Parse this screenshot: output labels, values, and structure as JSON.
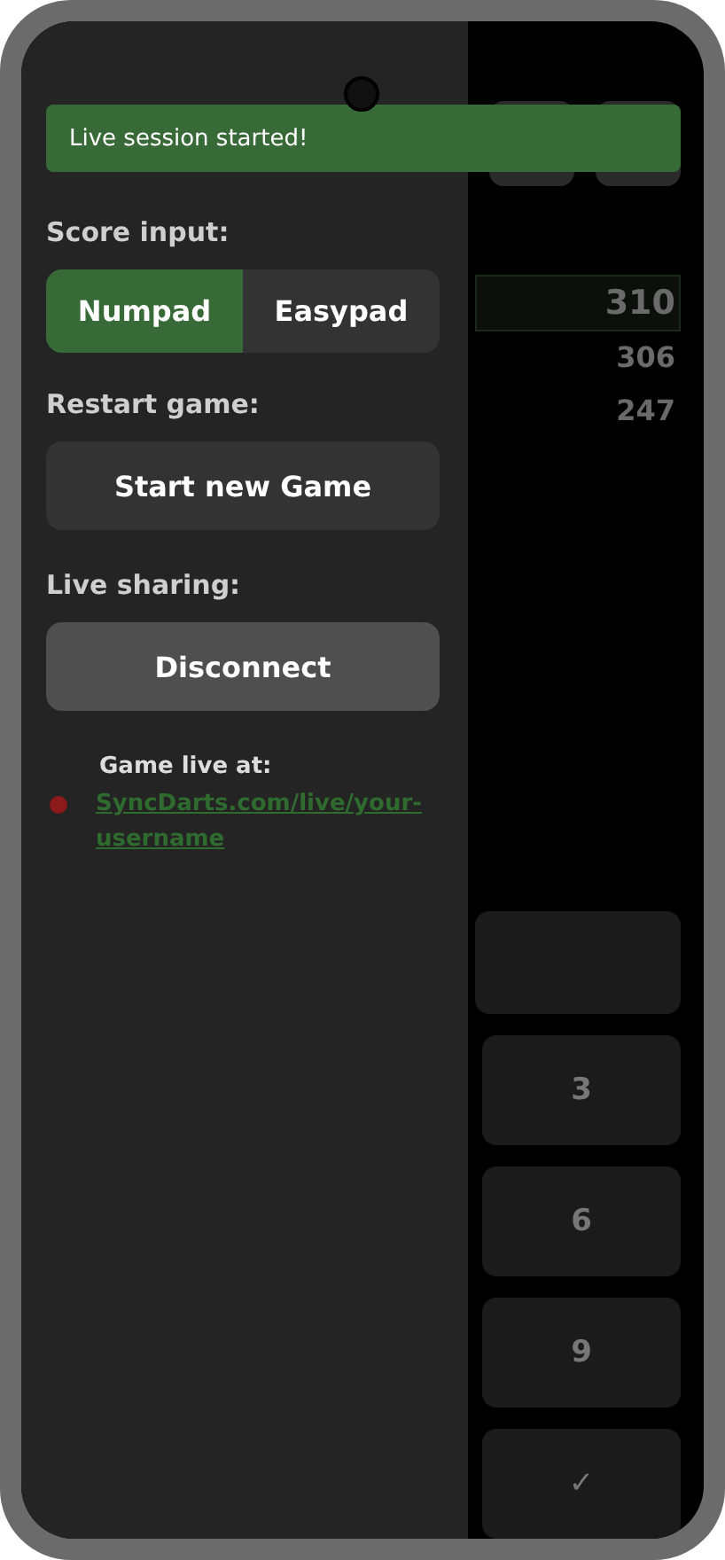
{
  "toast": {
    "text": "Live session started!"
  },
  "drawer": {
    "score_input": {
      "label": "Score input:",
      "options": [
        {
          "label": "Numpad",
          "selected": true
        },
        {
          "label": "Easypad",
          "selected": false
        }
      ]
    },
    "restart": {
      "label": "Restart game:",
      "button": "Start new Game"
    },
    "live_sharing": {
      "label": "Live sharing:",
      "button": "Disconnect",
      "caption": "Game live at:",
      "link": "SyncDarts.com/live/your-username"
    }
  },
  "background": {
    "scores": [
      {
        "value": "310",
        "selected": true
      },
      {
        "value": "306",
        "selected": false
      },
      {
        "value": "247",
        "selected": false
      }
    ],
    "keys": [
      "3",
      "6",
      "9",
      "✓"
    ]
  }
}
